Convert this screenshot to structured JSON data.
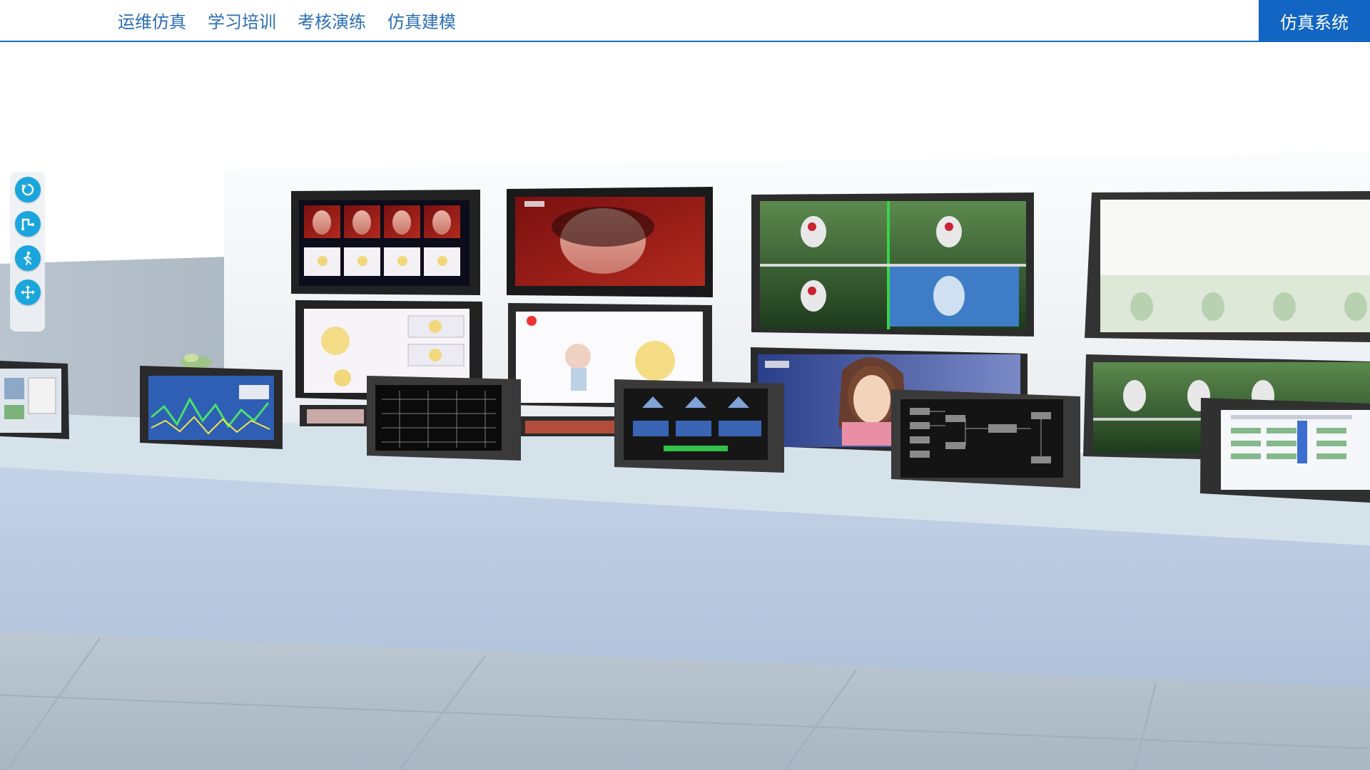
{
  "nav": {
    "items": [
      {
        "label": "运维仿真"
      },
      {
        "label": "学习培训"
      },
      {
        "label": "考核演练"
      },
      {
        "label": "仿真建模"
      }
    ],
    "system_label": "仿真系统"
  },
  "toolbar": {
    "buttons": [
      {
        "icon": "rotate-reset-icon"
      },
      {
        "icon": "route-path-icon"
      },
      {
        "icon": "walk-mode-icon"
      },
      {
        "icon": "move-pan-icon"
      }
    ]
  },
  "colors": {
    "accent": "#1265c2",
    "nav_text": "#2a6db5",
    "tool_button": "#1aa6dc"
  }
}
